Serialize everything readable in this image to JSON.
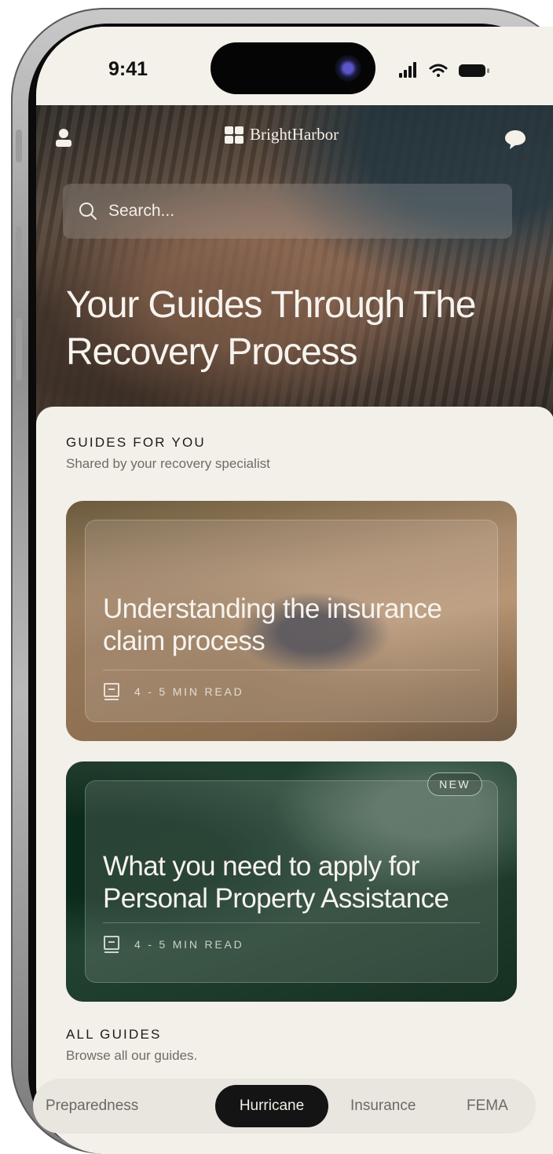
{
  "status_bar": {
    "time": "9:41"
  },
  "header": {
    "brand": "BrightHarbor"
  },
  "search": {
    "placeholder": "Search..."
  },
  "hero": {
    "title": "Your Guides Through The Recovery Process"
  },
  "guides_for_you": {
    "title": "GUIDES FOR YOU",
    "subtitle": "Shared by your recovery specialist",
    "cards": [
      {
        "title": "Understanding the insurance claim process",
        "meta": "4 - 5 MIN READ",
        "badge": ""
      },
      {
        "title": "What you need to apply for Personal Property Assistance",
        "meta": "4 - 5 MIN READ",
        "badge": "NEW"
      }
    ]
  },
  "all_guides": {
    "title": "ALL GUIDES",
    "subtitle": "Browse all our guides.",
    "categories": [
      "Preparedness",
      "Hurricane",
      "Insurance",
      "FEMA"
    ],
    "active_category": "Hurricane"
  },
  "colors": {
    "background": "#f3efe9",
    "active_chip": "#141414",
    "text_dark": "#1b1b1b"
  }
}
